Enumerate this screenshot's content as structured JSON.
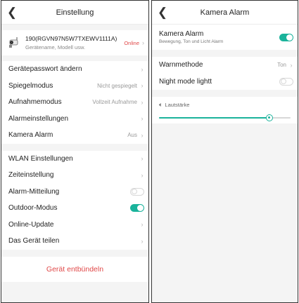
{
  "settings": {
    "title": "Einstellung",
    "device": {
      "name": "190(RGVN97N5W7TXEWV1111A)",
      "subtitle": "Gerätename, Modell usw.",
      "status": "Online"
    },
    "group1": [
      {
        "label": "Gerätepasswort ändern",
        "value": ""
      },
      {
        "label": "Spiegelmodus",
        "value": "Nicht gespiegelt"
      },
      {
        "label": "Aufnahmemodus",
        "value": "Vollzeit Aufnahme"
      },
      {
        "label": "Alarmeinstellungen",
        "value": ""
      },
      {
        "label": "Kamera Alarm",
        "value": "Aus"
      }
    ],
    "group2": [
      {
        "label": "WLAN Einstellungen"
      },
      {
        "label": "Zeiteinstellung"
      },
      {
        "label": "Alarm-Mitteilung",
        "toggle": false
      },
      {
        "label": "Outdoor-Modus",
        "toggle": true
      },
      {
        "label": "Online-Update"
      },
      {
        "label": "Das Gerät teilen"
      }
    ],
    "unbind_label": "Gerät entbündeln"
  },
  "camera_alarm": {
    "title": "Kamera Alarm",
    "header_title": "Kamera Alarm",
    "header_subtitle": "Bewegung, Ton und Licht Alarm",
    "header_toggle": true,
    "warn_label": "Warnmethode",
    "warn_value": "Ton",
    "night_label": "Night mode lightt",
    "night_toggle": false,
    "volume_label": "Lautstärke",
    "volume_level": 0.84
  },
  "colors": {
    "accent": "#1ab39b",
    "danger": "#e04848"
  },
  "icons": {
    "back": "chevron-left-icon",
    "chevron": "chevron-right-icon",
    "speaker": "speaker-icon",
    "camera": "camera-icon"
  }
}
